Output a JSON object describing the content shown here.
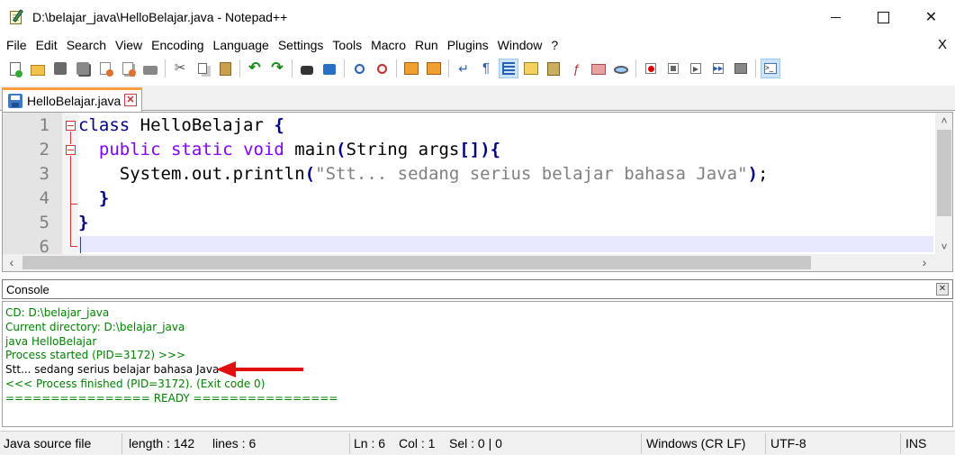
{
  "window": {
    "title": "D:\\belajar_java\\HelloBelajar.java - Notepad++",
    "close_glyph": "✕"
  },
  "menu": {
    "items": [
      "File",
      "Edit",
      "Search",
      "View",
      "Encoding",
      "Language",
      "Settings",
      "Tools",
      "Macro",
      "Run",
      "Plugins",
      "Window",
      "?"
    ],
    "close": "X"
  },
  "toolbar": {
    "icons": [
      "new-file-icon",
      "open-file-icon",
      "save-icon",
      "save-all-icon",
      "close-icon",
      "close-all-icon",
      "print-icon",
      "cut-icon",
      "copy-icon",
      "paste-icon",
      "undo-icon",
      "redo-icon",
      "find-icon",
      "replace-icon",
      "zoom-in-icon",
      "zoom-out-icon",
      "sync-vertical-icon",
      "sync-horizontal-icon",
      "word-wrap-icon",
      "show-all-chars-icon",
      "indent-guide-icon",
      "user-language-icon",
      "document-map-icon",
      "function-list-icon",
      "folder-workspace-icon",
      "monitoring-icon",
      "record-macro-icon",
      "stop-macro-icon",
      "play-macro-icon",
      "run-macro-multiple-icon",
      "save-macro-icon",
      "console-icon"
    ],
    "active": [
      "indent-guide-icon",
      "console-icon"
    ]
  },
  "tab": {
    "label": "HelloBelajar.java",
    "close_glyph": "✕"
  },
  "editor": {
    "lines": [
      {
        "num": "1",
        "tokens": [
          [
            "kw",
            "class"
          ],
          [
            "pl",
            " HelloBelajar "
          ],
          [
            "br",
            "{"
          ]
        ]
      },
      {
        "num": "2",
        "tokens": [
          [
            "pl",
            "  "
          ],
          [
            "tp",
            "public"
          ],
          [
            "pl",
            " "
          ],
          [
            "tp",
            "static"
          ],
          [
            "pl",
            " "
          ],
          [
            "tp",
            "void"
          ],
          [
            "pl",
            " main"
          ],
          [
            "br",
            "("
          ],
          [
            "pl",
            "String args"
          ],
          [
            "br",
            "[])"
          ],
          [
            "br",
            "{"
          ]
        ]
      },
      {
        "num": "3",
        "tokens": [
          [
            "pl",
            "    System.out.println"
          ],
          [
            "br",
            "("
          ],
          [
            "str",
            "\"Stt... sedang serius belajar bahasa Java\""
          ],
          [
            "br",
            ")"
          ],
          [
            "pl",
            ";"
          ]
        ]
      },
      {
        "num": "4",
        "tokens": [
          [
            "pl",
            "  "
          ],
          [
            "br",
            "}"
          ]
        ]
      },
      {
        "num": "5",
        "tokens": [
          [
            "br",
            "}"
          ]
        ]
      },
      {
        "num": "6",
        "tokens": []
      }
    ],
    "scroll_left": "‹",
    "scroll_right": "›",
    "scroll_up": "˄",
    "scroll_down": "˅"
  },
  "console": {
    "title": "Console",
    "close_glyph": "✕",
    "lines": [
      {
        "text": "CD: D:\\belajar_java",
        "kind": "info"
      },
      {
        "text": "Current directory: D:\\belajar_java",
        "kind": "info"
      },
      {
        "text": "java HelloBelajar",
        "kind": "info"
      },
      {
        "text": "Process started (PID=3172) >>>",
        "kind": "info"
      },
      {
        "text": "Stt... sedang serius belajar bahasa Java",
        "kind": "out"
      },
      {
        "text": "<<< Process finished (PID=3172). (Exit code 0)",
        "kind": "info"
      },
      {
        "text": "================ READY ================",
        "kind": "info"
      }
    ]
  },
  "statusbar": {
    "file_type": "Java source file",
    "length": "length : 142",
    "lines": "lines : 6",
    "ln": "Ln : 6",
    "col": "Col : 1",
    "sel": "Sel : 0 | 0",
    "eol": "Windows (CR LF)",
    "encoding": "UTF-8",
    "mode": "INS"
  },
  "colors": {
    "keyword": "#000080",
    "type": "#8000ff",
    "string": "#808080",
    "console_info": "#008000",
    "annotation_arrow": "#e01010",
    "tab_accent": "#f8a040"
  }
}
